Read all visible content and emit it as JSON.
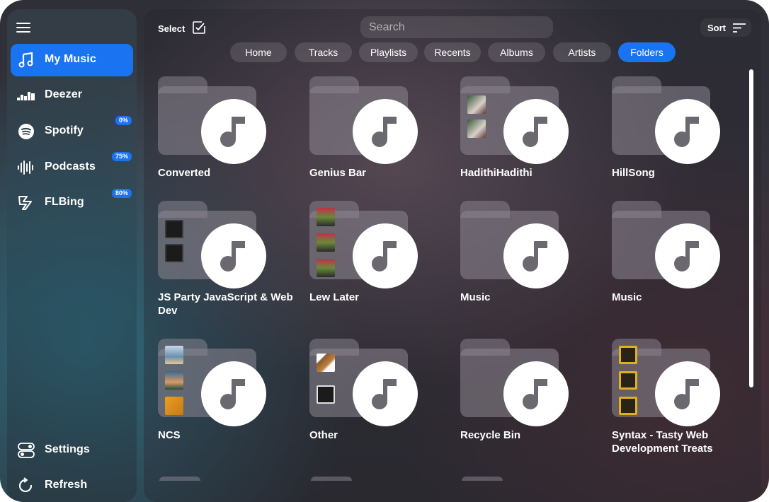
{
  "sidebar": {
    "items": [
      {
        "label": "My Music",
        "icon": "music-note-icon",
        "active": true
      },
      {
        "label": "Deezer",
        "icon": "deezer-icon"
      },
      {
        "label": "Spotify",
        "icon": "spotify-icon",
        "badge": "0%"
      },
      {
        "label": "Podcasts",
        "icon": "podcast-waves-icon",
        "badge": "75%"
      },
      {
        "label": "FLBing",
        "icon": "flbing-icon",
        "badge": "80%"
      }
    ],
    "footer": [
      {
        "label": "Settings",
        "icon": "settings-toggle-icon"
      },
      {
        "label": "Refresh",
        "icon": "refresh-icon"
      }
    ]
  },
  "toolbar": {
    "select_label": "Select",
    "search_placeholder": "Search",
    "sort_label": "Sort"
  },
  "tabs": [
    {
      "label": "Home"
    },
    {
      "label": "Tracks"
    },
    {
      "label": "Playlists"
    },
    {
      "label": "Recents"
    },
    {
      "label": "Albums"
    },
    {
      "label": "Artists"
    },
    {
      "label": "Folders",
      "active": true
    }
  ],
  "folders": [
    {
      "name": "Converted"
    },
    {
      "name": "Genius Bar"
    },
    {
      "name": "HadithiHadithi"
    },
    {
      "name": "HillSong"
    },
    {
      "name": "JS Party JavaScript & Web Dev"
    },
    {
      "name": "Lew Later"
    },
    {
      "name": "Music"
    },
    {
      "name": "Music"
    },
    {
      "name": "NCS"
    },
    {
      "name": "Other"
    },
    {
      "name": "Recycle Bin"
    },
    {
      "name": "Syntax - Tasty Web Development Treats"
    }
  ],
  "colors": {
    "accent": "#1a73f0"
  }
}
